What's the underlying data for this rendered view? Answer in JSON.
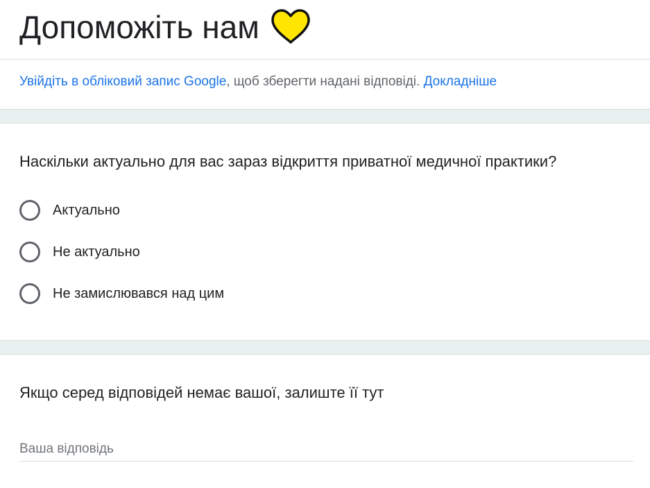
{
  "form": {
    "title": "Допоможіть нам",
    "title_icon": "yellow-heart-icon",
    "heart_color": "#FFE500"
  },
  "signin": {
    "link_text": "Увійдіть в обліковий запис Google",
    "middle_text": ", щоб зберегти надані відповіді.",
    "learn_more": "Докладніше"
  },
  "question1": {
    "text": "Наскільки актуально для вас зараз відкриття приватної медичної практики?",
    "options": [
      {
        "label": "Актуально",
        "selected": false
      },
      {
        "label": "Не актуально",
        "selected": false
      },
      {
        "label": "Не замислювався над цим",
        "selected": false
      }
    ]
  },
  "question2": {
    "text": "Якщо серед відповідей немає вашої, залиште її тут",
    "placeholder": "Ваша відповідь",
    "value": ""
  },
  "colors": {
    "link": "#1a73e8",
    "section_gap": "#e8f1ef",
    "radio_border": "#5f6368"
  }
}
